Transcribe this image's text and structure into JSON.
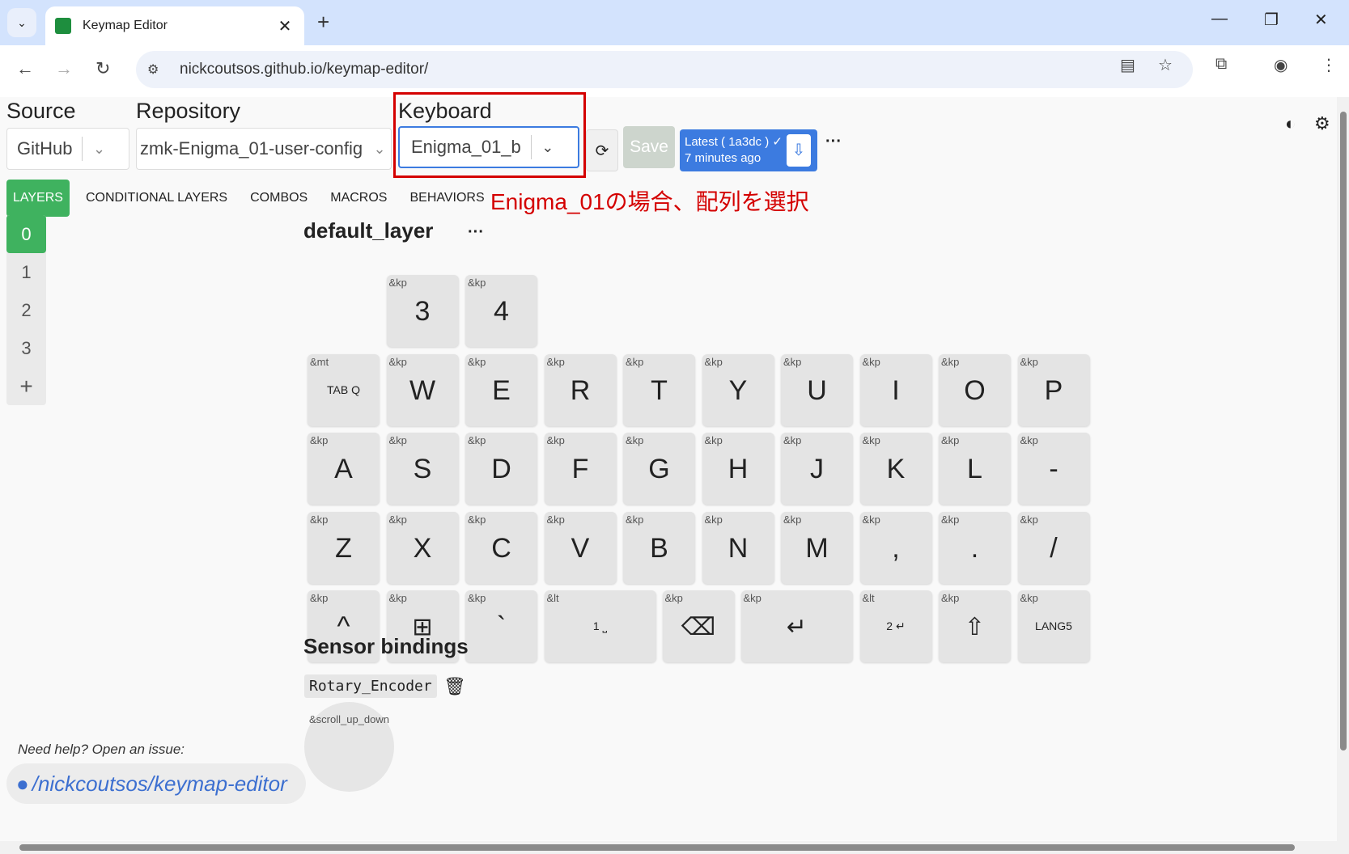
{
  "browser": {
    "tab_title": "Keymap Editor",
    "url": "nickcoutsos.github.io/keymap-editor/"
  },
  "toolbar": {
    "source_label": "Source",
    "source_value": "GitHub",
    "repository_label": "Repository",
    "repository_value": "zmk-Enigma_01-user-config",
    "keyboard_label": "Keyboard",
    "keyboard_value": "Enigma_01_b",
    "save_label": "Save",
    "latest_line1": "Latest ( 1a3dc ) ✓",
    "latest_line2": "7 minutes ago",
    "more": "···"
  },
  "tabs": [
    "LAYERS",
    "CONDITIONAL LAYERS",
    "COMBOS",
    "MACROS",
    "BEHAVIORS"
  ],
  "annotation": "Enigma_01の場合、配列を選択",
  "layers": [
    "0",
    "1",
    "2",
    "3",
    "+"
  ],
  "layer_title": "default_layer",
  "keys": [
    {
      "b": "&kp",
      "v": "3",
      "t": "n"
    },
    {
      "b": "&kp",
      "v": "4",
      "t": "n"
    },
    {
      "b": "&mt",
      "v": "TAB Q",
      "t": "s"
    },
    {
      "b": "&kp",
      "v": "W",
      "t": "n"
    },
    {
      "b": "&kp",
      "v": "E",
      "t": "n"
    },
    {
      "b": "&kp",
      "v": "R",
      "t": "n"
    },
    {
      "b": "&kp",
      "v": "T",
      "t": "n"
    },
    {
      "b": "&kp",
      "v": "Y",
      "t": "n"
    },
    {
      "b": "&kp",
      "v": "U",
      "t": "n"
    },
    {
      "b": "&kp",
      "v": "I",
      "t": "n"
    },
    {
      "b": "&kp",
      "v": "O",
      "t": "n"
    },
    {
      "b": "&kp",
      "v": "P",
      "t": "n"
    },
    {
      "b": "&kp",
      "v": "A",
      "t": "n"
    },
    {
      "b": "&kp",
      "v": "S",
      "t": "n"
    },
    {
      "b": "&kp",
      "v": "D",
      "t": "n"
    },
    {
      "b": "&kp",
      "v": "F",
      "t": "n"
    },
    {
      "b": "&kp",
      "v": "G",
      "t": "n"
    },
    {
      "b": "&kp",
      "v": "H",
      "t": "n"
    },
    {
      "b": "&kp",
      "v": "J",
      "t": "n"
    },
    {
      "b": "&kp",
      "v": "K",
      "t": "n"
    },
    {
      "b": "&kp",
      "v": "L",
      "t": "n"
    },
    {
      "b": "&kp",
      "v": "-",
      "t": "n"
    },
    {
      "b": "&kp",
      "v": "Z",
      "t": "n"
    },
    {
      "b": "&kp",
      "v": "X",
      "t": "n"
    },
    {
      "b": "&kp",
      "v": "C",
      "t": "n"
    },
    {
      "b": "&kp",
      "v": "V",
      "t": "n"
    },
    {
      "b": "&kp",
      "v": "B",
      "t": "n"
    },
    {
      "b": "&kp",
      "v": "N",
      "t": "n"
    },
    {
      "b": "&kp",
      "v": "M",
      "t": "n"
    },
    {
      "b": "&kp",
      "v": ",",
      "t": "n"
    },
    {
      "b": "&kp",
      "v": ".",
      "t": "n"
    },
    {
      "b": "&kp",
      "v": "/",
      "t": "n"
    },
    {
      "b": "&kp",
      "v": "^",
      "t": "n"
    },
    {
      "b": "&kp",
      "v": "⊞",
      "t": "i"
    },
    {
      "b": "&kp",
      "v": "`",
      "t": "n"
    },
    {
      "b": "&lt",
      "v": "1 ⎵",
      "t": "s"
    },
    {
      "b": "&kp",
      "v": "⌫",
      "t": "i"
    },
    {
      "b": "&kp",
      "v": "↵",
      "t": "i"
    },
    {
      "b": "&lt",
      "v": "2 ↵",
      "t": "s"
    },
    {
      "b": "&kp",
      "v": "⇧",
      "t": "i"
    },
    {
      "b": "&kp",
      "v": "LANG5",
      "t": "s"
    }
  ],
  "sensor": {
    "title": "Sensor bindings",
    "encoder": "Rotary_Encoder",
    "knob_label": "&scroll_up_down"
  },
  "footer": {
    "help": "Need help? Open an issue:",
    "link": "/nickcoutsos/keymap-editor"
  }
}
